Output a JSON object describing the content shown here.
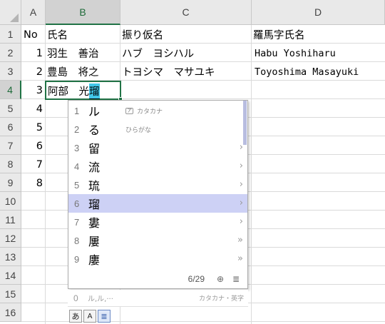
{
  "columns": [
    "A",
    "B",
    "C",
    "D"
  ],
  "selected_column": "B",
  "rows": [
    "1",
    "2",
    "3",
    "4",
    "5",
    "6",
    "7",
    "8",
    "9",
    "10",
    "11",
    "12",
    "13",
    "14",
    "15",
    "16"
  ],
  "selected_row": "4",
  "cells": {
    "a1": "No",
    "b1": "氏名",
    "c1": "振り仮名",
    "d1": "羅馬字氏名",
    "a2": "1",
    "b2": "羽生　善治",
    "c2": "ハブ　ヨシハル",
    "d2": "Habu  Yoshiharu",
    "a3": "2",
    "b3": "豊島　将之",
    "c3": "トヨシマ　マサユキ",
    "d3": "Toyoshima  Masayuki",
    "a4": "3",
    "a5": "4",
    "a6": "5",
    "a7": "6",
    "a8": "7",
    "a9": "8"
  },
  "active_cell": {
    "committed": "阿部　光",
    "composing": "瑠"
  },
  "ime": {
    "candidates": [
      {
        "n": "1",
        "text": "ル",
        "hint": "カタカナ",
        "hint_icon": "ア"
      },
      {
        "n": "2",
        "text": "る",
        "hint": "ひらがな"
      },
      {
        "n": "3",
        "text": "留",
        "arrow": "›"
      },
      {
        "n": "4",
        "text": "流",
        "arrow": "›"
      },
      {
        "n": "5",
        "text": "琉",
        "arrow": "›"
      },
      {
        "n": "6",
        "text": "瑠",
        "arrow": "›",
        "selected": true
      },
      {
        "n": "7",
        "text": "婁",
        "arrow": "›"
      },
      {
        "n": "8",
        "text": "屢",
        "arrow": "»"
      },
      {
        "n": "9",
        "text": "廔",
        "arrow": "»"
      }
    ],
    "page_indicator": "6/29",
    "zoom_icon": "⊕",
    "list_icon": "≣",
    "prediction": {
      "n": "0",
      "text": "ル,ル,···",
      "mode": "カタカナ・英字"
    },
    "toolbar": {
      "kana": "あ",
      "convert": "A",
      "list": "≣"
    }
  },
  "colors": {
    "accent": "#217346",
    "ime_selected": "#cdd1f5",
    "composing": "#41c7e8"
  }
}
